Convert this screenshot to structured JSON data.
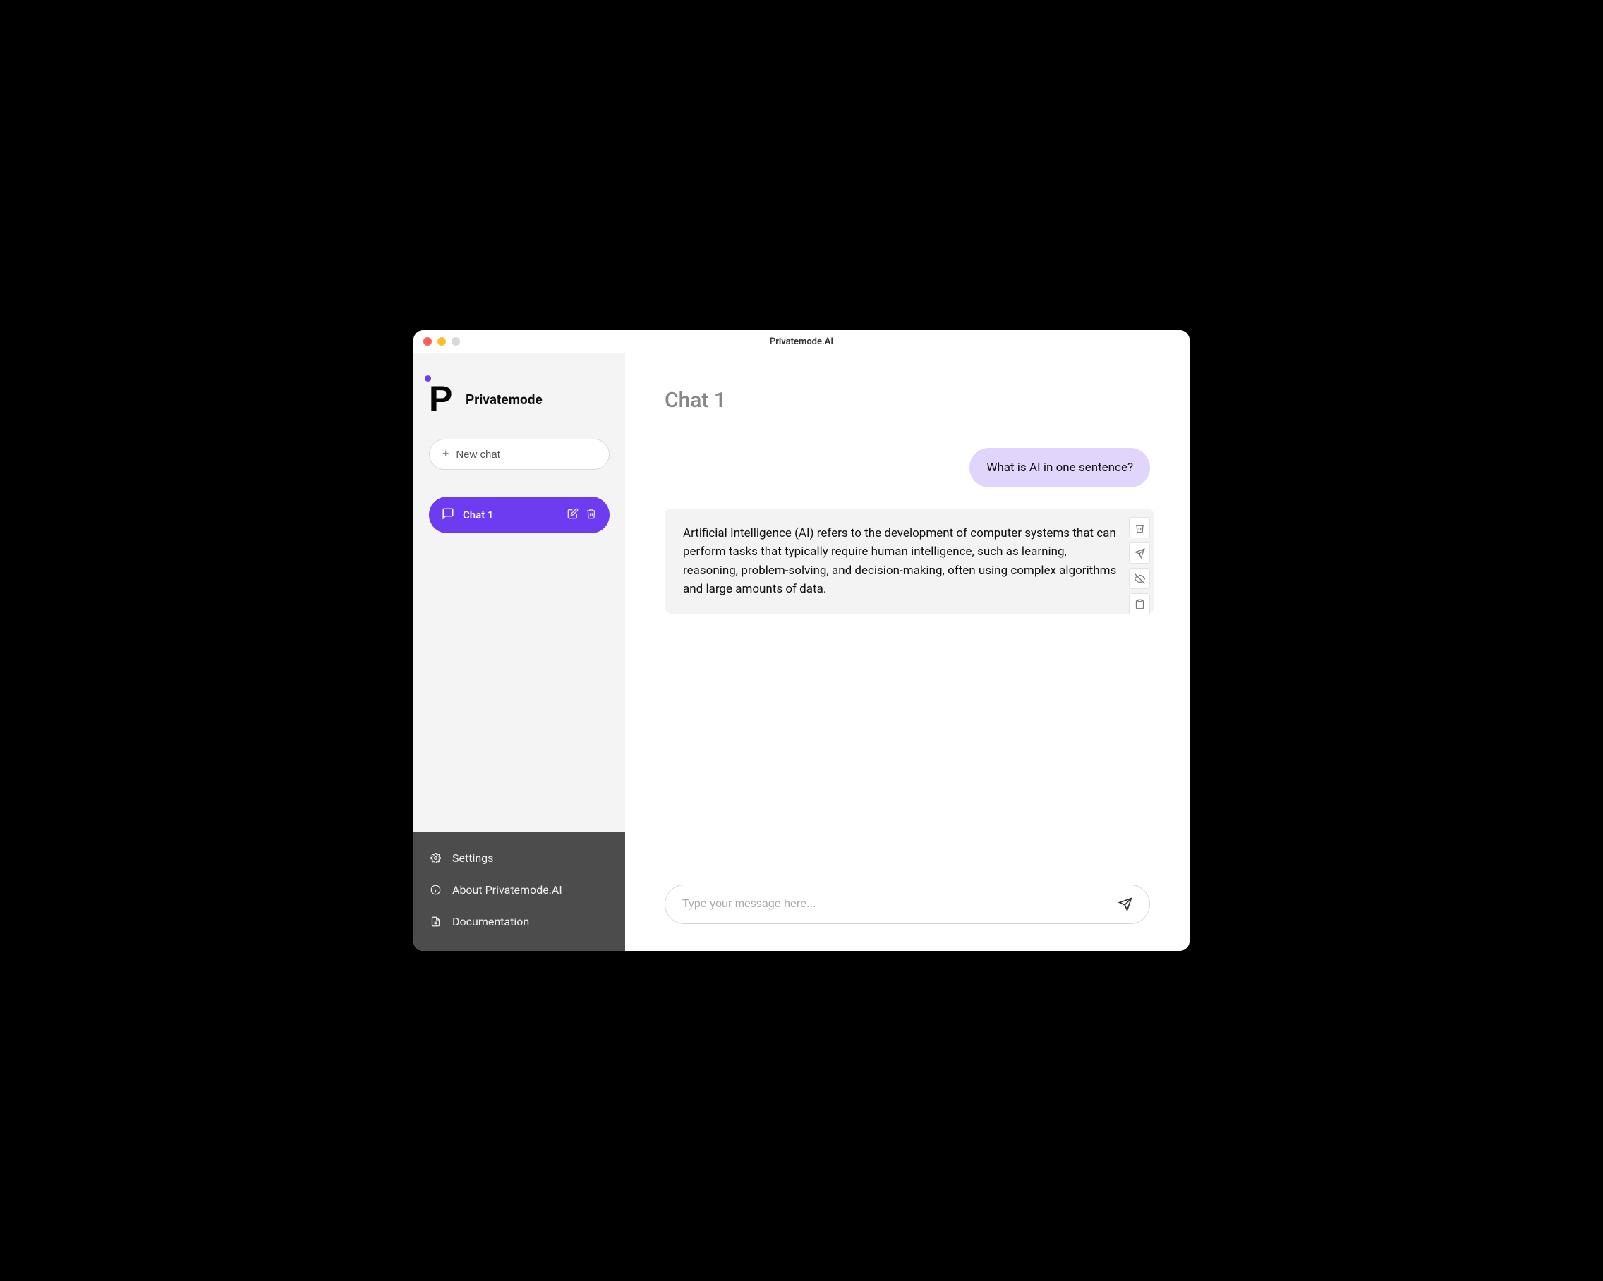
{
  "window": {
    "title": "Privatemode.AI"
  },
  "brand": {
    "name": "Privatemode"
  },
  "sidebar": {
    "new_chat_label": "New chat",
    "chats": [
      {
        "label": "Chat 1",
        "active": true
      }
    ],
    "footer": {
      "settings": "Settings",
      "about": "About Privatemode.AI",
      "docs": "Documentation"
    }
  },
  "chat": {
    "title": "Chat 1",
    "messages": [
      {
        "role": "user",
        "text": "What is AI in one sentence?"
      },
      {
        "role": "assistant",
        "text": "Artificial Intelligence (AI) refers to the development of computer systems that can perform tasks that typically require human intelligence, such as learning, reasoning, problem-solving, and decision-making, often using complex algorithms and large amounts of data."
      }
    ],
    "composer_placeholder": "Type your message here..."
  },
  "colors": {
    "accent": "#6d3cf0",
    "user_bubble": "#e1d5fb"
  }
}
